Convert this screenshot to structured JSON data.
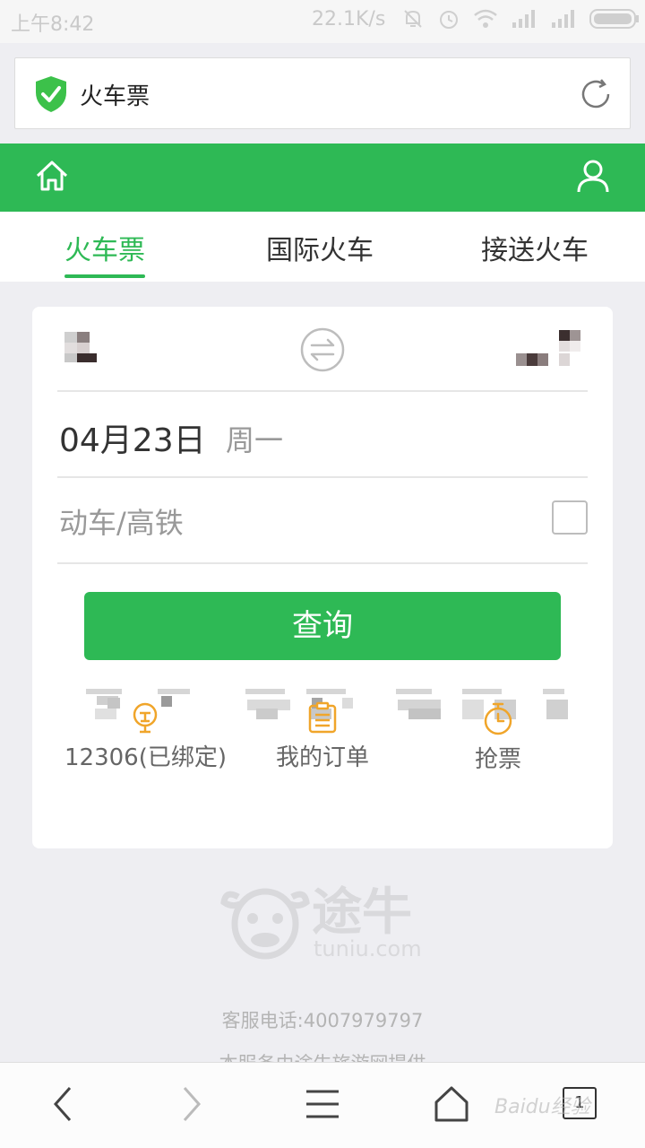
{
  "status_bar": {
    "time": "上午8:42",
    "speed": "22.1K/s"
  },
  "browser": {
    "url_title": "火车票"
  },
  "tabs": [
    {
      "label": "火车票",
      "active": true
    },
    {
      "label": "国际火车",
      "active": false
    },
    {
      "label": "接送火车",
      "active": false
    }
  ],
  "search": {
    "date": "04月23日",
    "weekday": "周一",
    "train_type_label": "动车/高铁",
    "high_speed_only": false,
    "query_button": "查询"
  },
  "quick_links": [
    {
      "label": "12306(已绑定)",
      "icon": "bound-account-icon"
    },
    {
      "label": "我的订单",
      "icon": "order-clipboard-icon"
    },
    {
      "label": "抢票",
      "icon": "stopwatch-icon"
    }
  ],
  "footer": {
    "logo_cn": "途牛",
    "logo_en": "tuniu.com",
    "service_phone": "客服电话:4007979797",
    "provider": "本服务由途牛旅游网提供"
  },
  "bottom_nav": {
    "tab_count": "1",
    "watermark": "Baidu经验"
  },
  "colors": {
    "brand_green": "#2eb955",
    "accent_orange": "#f0a52a"
  }
}
